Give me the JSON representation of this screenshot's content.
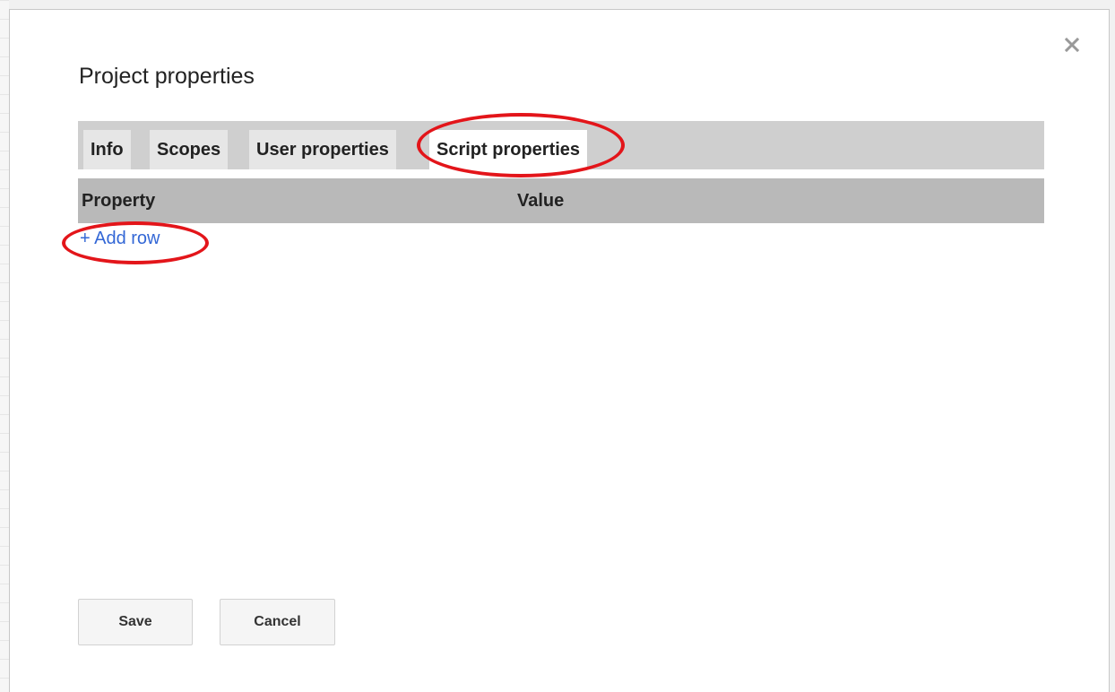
{
  "dialog": {
    "title": "Project properties",
    "close_icon": "close-icon"
  },
  "tabs": [
    {
      "label": "Info",
      "active": false
    },
    {
      "label": "Scopes",
      "active": false
    },
    {
      "label": "User properties",
      "active": false
    },
    {
      "label": "Script properties",
      "active": true
    }
  ],
  "table": {
    "columns": [
      "Property",
      "Value"
    ],
    "add_row_label": "+ Add row"
  },
  "buttons": {
    "save_label": "Save",
    "cancel_label": "Cancel"
  },
  "colors": {
    "annotation": "#e3151a",
    "link": "#3367d6",
    "tab_strip": "#cfcfcf",
    "header_row": "#b9b9b9"
  }
}
